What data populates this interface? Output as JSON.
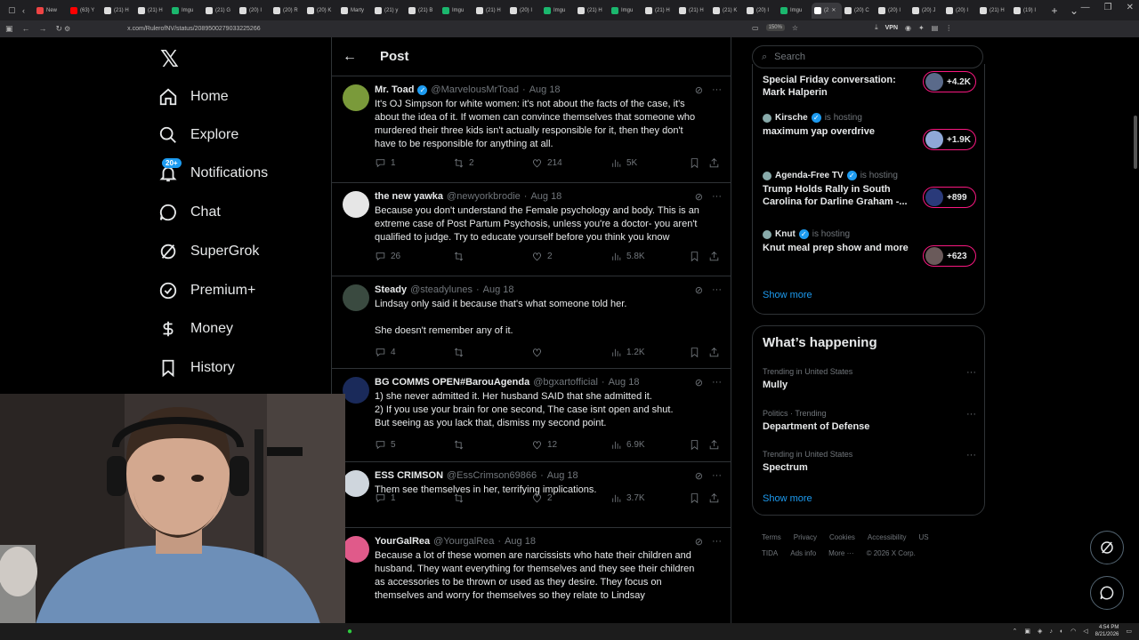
{
  "browser": {
    "tabs": [
      {
        "label": "New",
        "color": "#e44"
      },
      {
        "label": "(63) Y",
        "color": "#f00"
      },
      {
        "label": "(21) H",
        "color": "#ddd"
      },
      {
        "label": "(21) H",
        "color": "#ddd"
      },
      {
        "label": "Imgu",
        "color": "#1bb76e"
      },
      {
        "label": "(21) G",
        "color": "#ddd"
      },
      {
        "label": "(20) I",
        "color": "#ddd"
      },
      {
        "label": "(20) R",
        "color": "#ddd"
      },
      {
        "label": "(20) K",
        "color": "#ddd"
      },
      {
        "label": "Marty",
        "color": "#ddd"
      },
      {
        "label": "(21) y",
        "color": "#ddd"
      },
      {
        "label": "(21) B",
        "color": "#ddd"
      },
      {
        "label": "Imgu",
        "color": "#1bb76e"
      },
      {
        "label": "(21) H",
        "color": "#ddd"
      },
      {
        "label": "(20) I",
        "color": "#ddd"
      },
      {
        "label": "Imgu",
        "color": "#1bb76e"
      },
      {
        "label": "(21) H",
        "color": "#ddd"
      },
      {
        "label": "Imgu",
        "color": "#1bb76e"
      },
      {
        "label": "(21) H",
        "color": "#ddd"
      },
      {
        "label": "(21) H",
        "color": "#ddd"
      },
      {
        "label": "(21) K",
        "color": "#ddd"
      },
      {
        "label": "(20) I",
        "color": "#ddd"
      },
      {
        "label": "Imgu",
        "color": "#1bb76e"
      }
    ],
    "active_tab": "(2",
    "trailing_tabs": [
      "(20) C",
      "(20) I",
      "(20) J",
      "(20) I",
      "(21) H",
      "(19) I"
    ],
    "url": "x.com/RulerofNV/status/2089500279033225266",
    "zoom": "150%",
    "vpn_label": "VPN"
  },
  "sidebar": {
    "logo": "𝕏",
    "items": [
      {
        "label": "Home",
        "icon": "home-icon"
      },
      {
        "label": "Explore",
        "icon": "search-icon"
      },
      {
        "label": "Notifications",
        "icon": "bell-icon",
        "badge": "20+"
      },
      {
        "label": "Chat",
        "icon": "chat-icon"
      },
      {
        "label": "SuperGrok",
        "icon": "grok-icon"
      },
      {
        "label": "Premium+",
        "icon": "verified-icon"
      },
      {
        "label": "Money",
        "icon": "dollar-icon"
      },
      {
        "label": "History",
        "icon": "bookmark-icon"
      }
    ]
  },
  "header": {
    "back": "←",
    "title": "Post"
  },
  "tweets": [
    {
      "name": "Mr. Toad",
      "verified": true,
      "handle": "@MarvelousMrToad",
      "date": "Aug 18",
      "body": "It's OJ Simpson for white women: it's not about the facts of the case, it's\nabout the idea of it. If women can convince themselves that someone who\nmurdered their three kids isn't actually responsible for it, then they don't\nhave to be responsible for anything at all.",
      "replies": "1",
      "reposts": "2",
      "likes": "214",
      "views": "5K",
      "avatar_color": "#7a9a3a"
    },
    {
      "name": "the new yawka",
      "verified": false,
      "handle": "@newyorkbrodie",
      "date": "Aug 18",
      "body": "Because you don't understand the Female psychology and body. This is an\nextreme case of Post Partum Psychosis, unless you're a doctor- you aren't\nqualified to judge. Try to educate yourself before you think you know",
      "replies": "26",
      "reposts": "",
      "likes": "2",
      "views": "5.8K",
      "avatar_color": "#e6e6e6"
    },
    {
      "name": "Steady",
      "verified": false,
      "handle": "@steadylunes",
      "date": "Aug 18",
      "body": "Lindsay only said it because that's what someone told her.\n\nShe doesn't remember any of it.",
      "replies": "4",
      "reposts": "",
      "likes": "",
      "views": "1.2K",
      "avatar_color": "#3a4a40"
    },
    {
      "name": "BG COMMS OPEN#BarouAgenda",
      "verified": false,
      "handle": "@bgxartofficial",
      "date": "Aug 18",
      "body": "1) she never admitted it. Her husband SAID that she admitted it.\n2) If you use your brain for one second, The case isnt open and shut.\nBut seeing as you lack that, dismiss my second point.",
      "replies": "5",
      "reposts": "",
      "likes": "12",
      "views": "6.9K",
      "avatar_color": "#1a2a5a"
    },
    {
      "name": "ESS CRIMSON",
      "verified": false,
      "handle": "@EssCrimson69866",
      "date": "Aug 18",
      "body": "Them see themselves in her, terrifying implications.",
      "replies": "1",
      "reposts": "",
      "likes": "2",
      "views": "3.7K",
      "avatar_color": "#cfd6dd"
    },
    {
      "name": "YourGalRea",
      "verified": false,
      "handle": "@YourgalRea",
      "date": "Aug 18",
      "body": "Because a lot of these women are narcissists who hate their children and\nhusband. They want everything for themselves and they see their children\nas accessories to be thrown or used as they desire. They focus on\nthemselves and worry for themselves so they relate to Lindsay",
      "replies": "",
      "reposts": "",
      "likes": "",
      "views": "",
      "avatar_color": "#e05a8a"
    }
  ],
  "right": {
    "search_placeholder": "Search",
    "spaces": [
      {
        "host": "",
        "hosting": "",
        "title": "Special Friday conversation:\nMark Halperin",
        "count": "+4.2K",
        "pill_color": "#5a6a8a"
      },
      {
        "host": "Kirsche",
        "hosting": "is hosting",
        "title": "maximum yap overdrive",
        "count": "+1.9K",
        "pill_color": "#8fa8d8"
      },
      {
        "host": "Agenda-Free TV",
        "hosting": "is hosting",
        "title": "Trump Holds Rally in South\nCarolina for Darline Graham -...",
        "count": "+899",
        "pill_color": "#2a3a7a"
      },
      {
        "host": "Knut",
        "hosting": "is hosting",
        "title": "Knut meal prep show and more",
        "count": "+623",
        "pill_color": "#6a5a5a"
      }
    ],
    "show_more_1": "Show more",
    "happening_title": "What’s happening",
    "trends": [
      {
        "meta": "Trending in United States",
        "name": "Mully"
      },
      {
        "meta": "Politics · Trending",
        "name": "Department of Defense"
      },
      {
        "meta": "Trending in United States",
        "name": "Spectrum"
      }
    ],
    "show_more_2": "Show more",
    "footer": [
      "Terms",
      "Privacy",
      "Cookies",
      "Accessibility",
      "US TIDA",
      "Ads info",
      "More ···",
      "© 2026 X Corp."
    ]
  },
  "taskbar": {
    "time": "4:54 PM",
    "date": "8/21/2026"
  }
}
